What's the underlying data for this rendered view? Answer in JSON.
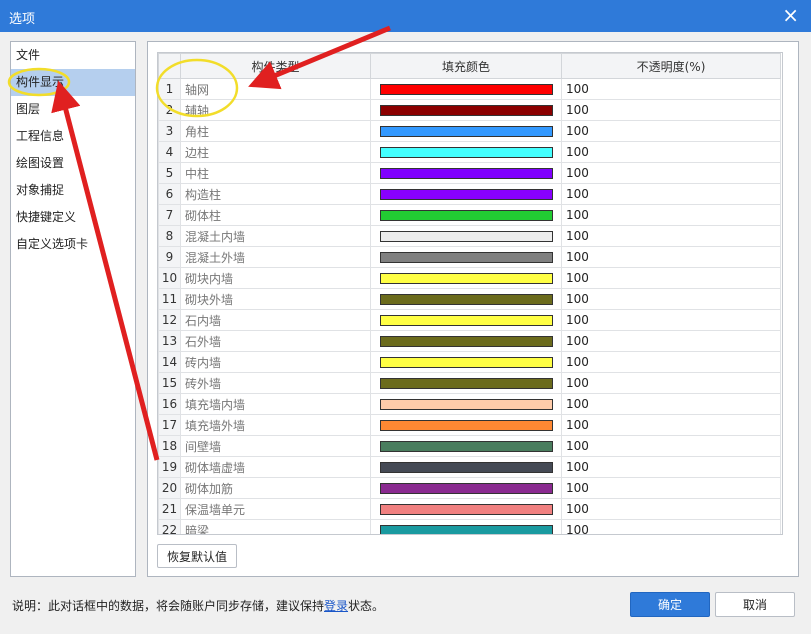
{
  "window": {
    "title": "选项",
    "close_glyph": "×"
  },
  "sidebar": {
    "items": [
      {
        "label": "文件"
      },
      {
        "label": "构件显示"
      },
      {
        "label": "图层"
      },
      {
        "label": "工程信息"
      },
      {
        "label": "绘图设置"
      },
      {
        "label": "对象捕捉"
      },
      {
        "label": "快捷键定义"
      },
      {
        "label": "自定义选项卡"
      }
    ],
    "active_index": 1
  },
  "table": {
    "columns": [
      "",
      "构件类型",
      "填充颜色",
      "不透明度(%)"
    ],
    "rows": [
      {
        "index": "1",
        "name": "轴网",
        "color": "#ff0000",
        "opacity": "100"
      },
      {
        "index": "2",
        "name": "辅轴",
        "color": "#8b0000",
        "opacity": "100"
      },
      {
        "index": "3",
        "name": "角柱",
        "color": "#3399ff",
        "opacity": "100"
      },
      {
        "index": "4",
        "name": "边柱",
        "color": "#44ffff",
        "opacity": "100"
      },
      {
        "index": "5",
        "name": "中柱",
        "color": "#8000ff",
        "opacity": "100"
      },
      {
        "index": "6",
        "name": "构造柱",
        "color": "#8800ff",
        "opacity": "100"
      },
      {
        "index": "7",
        "name": "砌体柱",
        "color": "#22cc33",
        "opacity": "100"
      },
      {
        "index": "8",
        "name": "混凝土内墙",
        "color": "#ececec",
        "opacity": "100"
      },
      {
        "index": "9",
        "name": "混凝土外墙",
        "color": "#808080",
        "opacity": "100"
      },
      {
        "index": "10",
        "name": "砌块内墙",
        "color": "#ffff44",
        "opacity": "100"
      },
      {
        "index": "11",
        "name": "砌块外墙",
        "color": "#6b6b1c",
        "opacity": "100"
      },
      {
        "index": "12",
        "name": "石内墙",
        "color": "#ffff44",
        "opacity": "100"
      },
      {
        "index": "13",
        "name": "石外墙",
        "color": "#6b6b1c",
        "opacity": "100"
      },
      {
        "index": "14",
        "name": "砖内墙",
        "color": "#ffff44",
        "opacity": "100"
      },
      {
        "index": "15",
        "name": "砖外墙",
        "color": "#6b6b1c",
        "opacity": "100"
      },
      {
        "index": "16",
        "name": "填充墙内墙",
        "color": "#ffccaa",
        "opacity": "100"
      },
      {
        "index": "17",
        "name": "填充墙外墙",
        "color": "#ff8833",
        "opacity": "100"
      },
      {
        "index": "18",
        "name": "间壁墙",
        "color": "#4a7d5e",
        "opacity": "100"
      },
      {
        "index": "19",
        "name": "砌体墙虚墙",
        "color": "#454a55",
        "opacity": "100"
      },
      {
        "index": "20",
        "name": "砌体加筋",
        "color": "#8a2a90",
        "opacity": "100"
      },
      {
        "index": "21",
        "name": "保温墙单元",
        "color": "#f08080",
        "opacity": "100"
      },
      {
        "index": "22",
        "name": "暗梁",
        "color": "#1a9aa0",
        "opacity": "100"
      }
    ]
  },
  "buttons": {
    "restore_defaults": "恢复默认值",
    "ok": "确定",
    "cancel": "取消"
  },
  "footer": {
    "note_prefix": "说明：此对话框中的数据，将会随账户同步存储，建议保持",
    "login_link": "登录",
    "note_suffix": "状态。"
  }
}
